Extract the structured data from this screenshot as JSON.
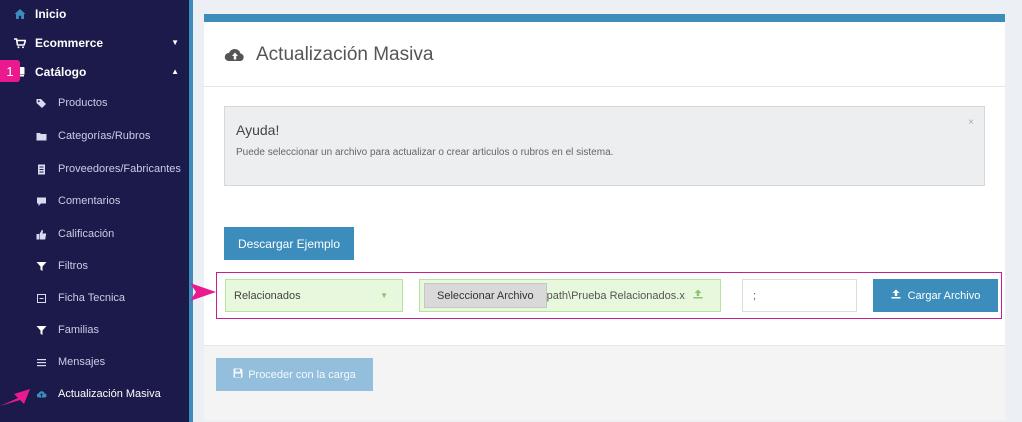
{
  "sidebar": {
    "top_items": [
      {
        "label": "Inicio",
        "icon": "home-icon"
      },
      {
        "label": "Ecommerce",
        "icon": "cart-icon"
      },
      {
        "label": "Catálogo",
        "icon": "book-icon"
      }
    ],
    "sub_items": [
      {
        "label": "Productos",
        "icon": "tags-icon"
      },
      {
        "label": "Categorías/Rubros",
        "icon": "folder-icon"
      },
      {
        "label": "Proveedores/Fabricantes",
        "icon": "building-icon"
      },
      {
        "label": "Comentarios",
        "icon": "comment-icon"
      },
      {
        "label": "Calificación",
        "icon": "thumbs-up-icon"
      },
      {
        "label": "Filtros",
        "icon": "filter-icon"
      },
      {
        "label": "Ficha Tecnica",
        "icon": "square-minus-icon"
      },
      {
        "label": "Familias",
        "icon": "filter-icon"
      },
      {
        "label": "Mensajes",
        "icon": "list-icon"
      },
      {
        "label": "Actualización Masiva",
        "icon": "cloud-upload-icon"
      }
    ],
    "colors": {
      "bg": "#1b1a4a",
      "accent": "#3c8dbc"
    }
  },
  "annotation": {
    "badge": "1",
    "color": "#ea1a8e"
  },
  "panel": {
    "title": "Actualización Masiva",
    "help": {
      "title": "Ayuda!",
      "text": "Puede seleccionar un archivo para actualizar o crear articulos o rubros en el sistema.",
      "close": "×"
    },
    "download_button": "Descargar Ejemplo",
    "type_select": {
      "value": "Relacionados",
      "arrow": "▼"
    },
    "file_button": "Seleccionar Archivo",
    "file_path": "path\\Prueba Relacionados.x",
    "separator_value": ";",
    "upload_button": "Cargar Archivo",
    "proceed_button": "Proceder con la carga"
  }
}
